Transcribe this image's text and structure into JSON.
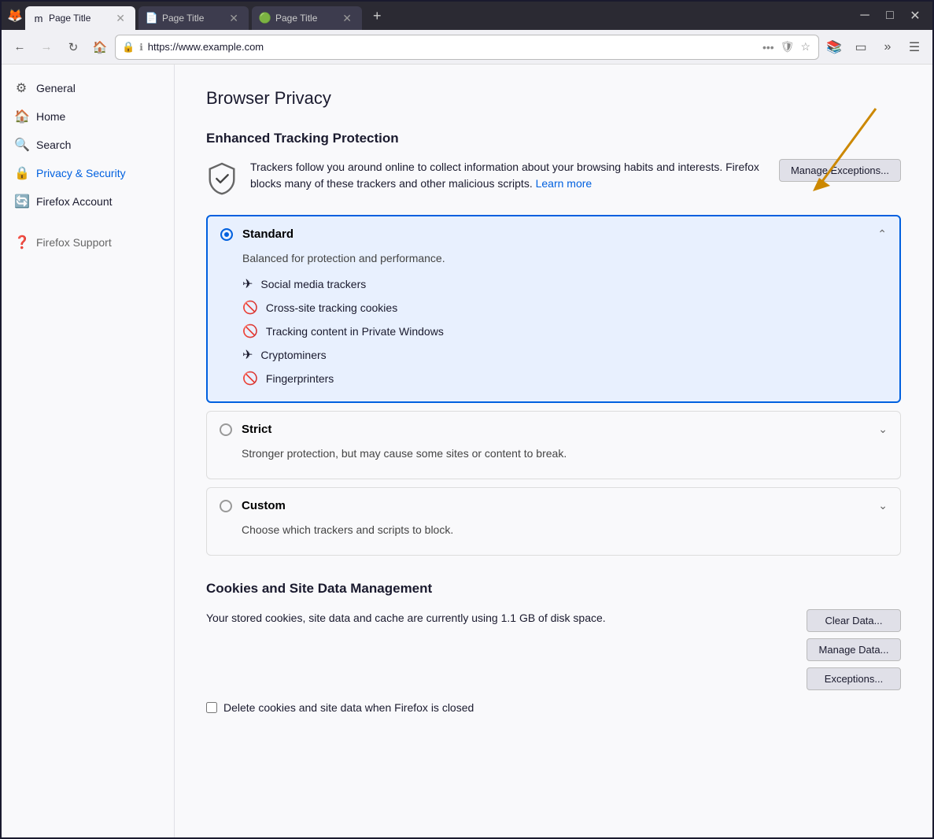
{
  "browser": {
    "tabs": [
      {
        "id": "tab1",
        "title": "Page Title",
        "favicon": "🦊",
        "active": true
      },
      {
        "id": "tab2",
        "title": "Page Title",
        "favicon": "📄",
        "active": false
      },
      {
        "id": "tab3",
        "title": "Page Title",
        "favicon": "🟢",
        "active": false
      }
    ],
    "url": "https://www.example.com",
    "new_tab_label": "+",
    "window_controls": {
      "minimize": "─",
      "maximize": "□",
      "close": "✕"
    }
  },
  "nav": {
    "back_disabled": false,
    "forward_disabled": true
  },
  "sidebar": {
    "items": [
      {
        "id": "general",
        "label": "General",
        "icon": "⚙"
      },
      {
        "id": "home",
        "label": "Home",
        "icon": "🏠"
      },
      {
        "id": "search",
        "label": "Search",
        "icon": "🔍"
      },
      {
        "id": "privacy",
        "label": "Privacy & Security",
        "icon": "🔒",
        "active": true
      },
      {
        "id": "account",
        "label": "Firefox Account",
        "icon": "🔄"
      }
    ],
    "support": {
      "label": "Firefox Support",
      "icon": "❓"
    }
  },
  "content": {
    "page_title": "Browser Privacy",
    "etp": {
      "section_title": "Enhanced Tracking Protection",
      "description": "Trackers follow you around online to collect information about your browsing habits and interests. Firefox blocks many of these trackers and other malicious scripts.",
      "learn_more": "Learn more",
      "manage_exceptions_btn": "Manage Exceptions..."
    },
    "protection_modes": [
      {
        "id": "standard",
        "label": "Standard",
        "description": "Balanced for protection and performance.",
        "selected": true,
        "items": [
          "Social media trackers",
          "Cross-site tracking cookies",
          "Tracking content in Private Windows",
          "Cryptominers",
          "Fingerprinters"
        ]
      },
      {
        "id": "strict",
        "label": "Strict",
        "description": "Stronger protection, but may cause some sites or content to break.",
        "selected": false,
        "items": []
      },
      {
        "id": "custom",
        "label": "Custom",
        "description": "Choose which trackers and scripts to block.",
        "selected": false,
        "items": []
      }
    ],
    "cookies": {
      "section_title": "Cookies and Site Data Management",
      "description": "Your stored cookies, site data and cache are currently using 1.1 GB of disk space.",
      "clear_data_btn": "Clear Data...",
      "manage_data_btn": "Manage Data...",
      "exceptions_btn": "Exceptions...",
      "delete_checkbox_label": "Delete cookies and site data when Firefox is closed"
    }
  }
}
